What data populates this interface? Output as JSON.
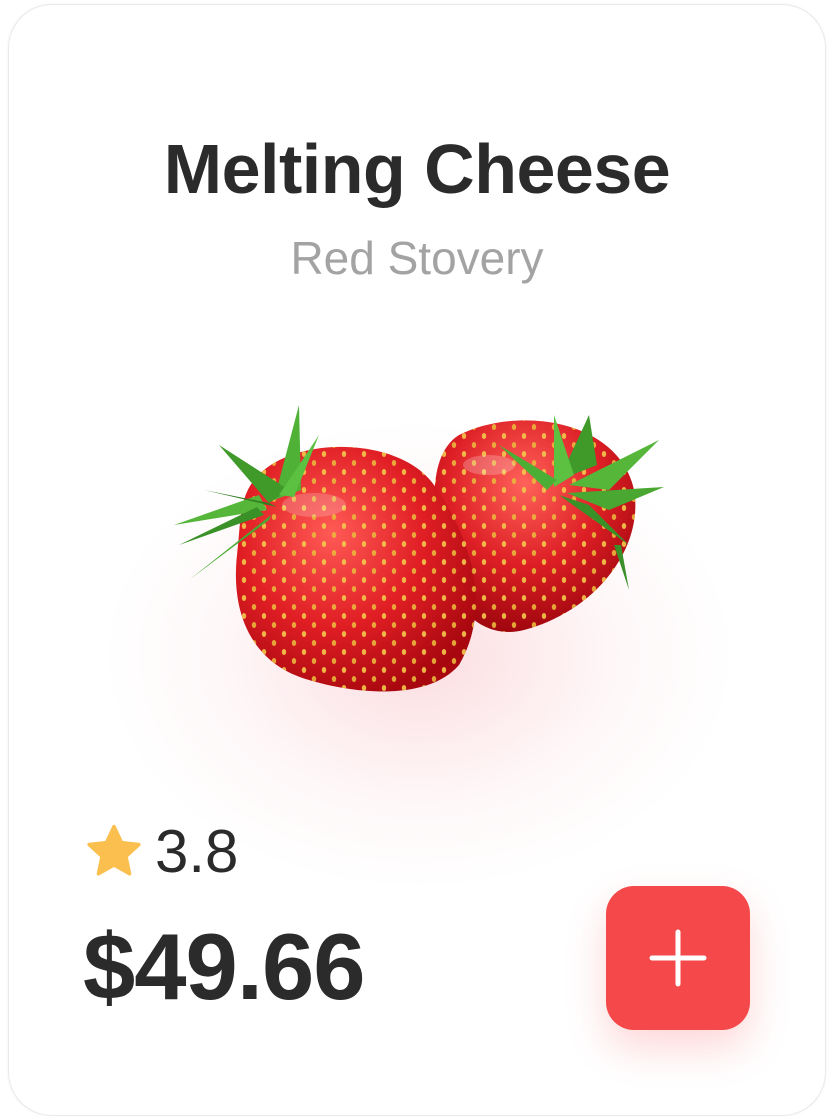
{
  "product": {
    "name": "Melting Cheese",
    "vendor": "Red Stovery",
    "image_icon": "strawberries-image",
    "rating": "3.8",
    "rating_icon": "star-icon",
    "price": "$49.66"
  },
  "actions": {
    "add_icon": "plus-icon"
  },
  "colors": {
    "accent": "#f4484a",
    "star": "#fbbf4f",
    "title": "#2b2b2b",
    "subtitle": "#a3a3a3"
  }
}
